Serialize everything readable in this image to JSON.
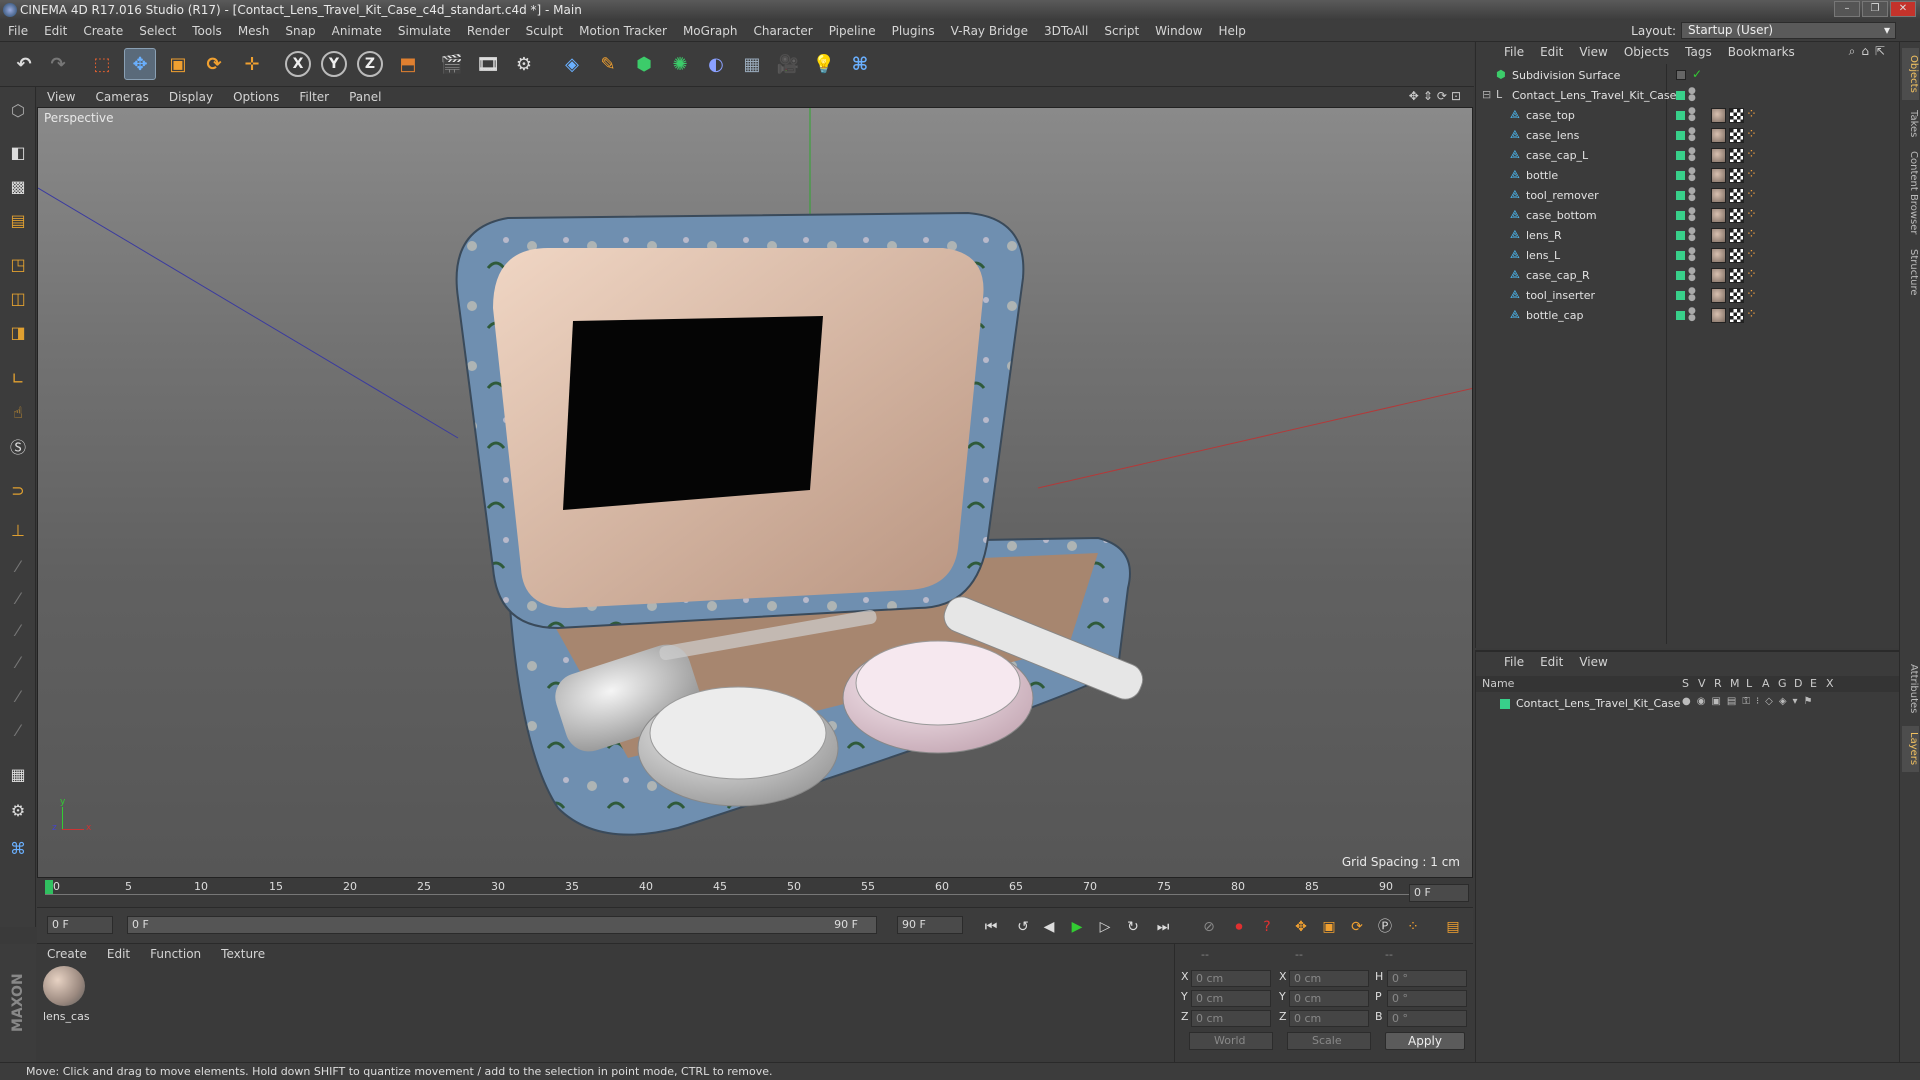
{
  "window": {
    "title": "CINEMA 4D R17.016 Studio (R17) - [Contact_Lens_Travel_Kit_Case_c4d_standart.c4d *] - Main",
    "controls": [
      "–",
      "❐",
      "✕"
    ]
  },
  "menu": [
    "File",
    "Edit",
    "Create",
    "Select",
    "Tools",
    "Mesh",
    "Snap",
    "Animate",
    "Simulate",
    "Render",
    "Sculpt",
    "Motion Tracker",
    "MoGraph",
    "Character",
    "Pipeline",
    "Plugins",
    "V-Ray Bridge",
    "3DToAll",
    "Script",
    "Window",
    "Help"
  ],
  "layout": {
    "label": "Layout:",
    "value": "Startup (User)"
  },
  "toolbar": {
    "x": "X",
    "y": "Y",
    "z": "Z"
  },
  "viewport": {
    "menu": [
      "View",
      "Cameras",
      "Display",
      "Options",
      "Filter",
      "Panel"
    ],
    "label": "Perspective",
    "grid_spacing": "Grid Spacing : 1 cm",
    "nav_icons": "✥⇕⟳⊡",
    "axis": {
      "x": "x",
      "y": "y",
      "z": "z"
    }
  },
  "timeline": {
    "ticks": [
      "0",
      "5",
      "10",
      "15",
      "20",
      "25",
      "30",
      "35",
      "40",
      "45",
      "50",
      "55",
      "60",
      "65",
      "70",
      "75",
      "80",
      "85",
      "90"
    ],
    "current_field": "0 F",
    "start_field": "0 F",
    "range_start": "0 F",
    "range_end": "90 F",
    "end_field": "90 F"
  },
  "material_manager": {
    "menu": [
      "Create",
      "Edit",
      "Function",
      "Texture"
    ],
    "material_name": "lens_cas"
  },
  "brand": "MAXON CINEMA 4D",
  "coords": {
    "col_heads": [
      "--",
      "--",
      "--"
    ],
    "rows": [
      {
        "a": "X",
        "v1": "0 cm",
        "b": "X",
        "v2": "0 cm",
        "c": "H",
        "v3": "0 °"
      },
      {
        "a": "Y",
        "v1": "0 cm",
        "b": "Y",
        "v2": "0 cm",
        "c": "P",
        "v3": "0 °"
      },
      {
        "a": "Z",
        "v1": "0 cm",
        "b": "Z",
        "v2": "0 cm",
        "c": "B",
        "v3": "0 °"
      }
    ],
    "world": "World",
    "scale": "Scale",
    "apply": "Apply"
  },
  "status": "Move: Click and drag to move elements. Hold down SHIFT to quantize movement / add to the selection in point mode, CTRL to remove.",
  "object_manager": {
    "menu": [
      "File",
      "Edit",
      "View",
      "Objects",
      "Tags",
      "Bookmarks"
    ],
    "root": "Subdivision Surface",
    "group": "Contact_Lens_Travel_Kit_Case",
    "objects": [
      "case_top",
      "case_lens",
      "case_cap_L",
      "bottle",
      "tool_remover",
      "case_bottom",
      "lens_R",
      "lens_L",
      "case_cap_R",
      "tool_inserter",
      "bottle_cap"
    ]
  },
  "layer_manager": {
    "menu": [
      "File",
      "Edit",
      "View"
    ],
    "headers": [
      "Name",
      "S",
      "V",
      "R",
      "M",
      "L",
      "A",
      "G",
      "D",
      "E",
      "X"
    ],
    "layer": "Contact_Lens_Travel_Kit_Case"
  },
  "right_tabs": [
    "Objects",
    "Takes",
    "Content Browser",
    "Structure",
    "Attributes",
    "Layers"
  ]
}
